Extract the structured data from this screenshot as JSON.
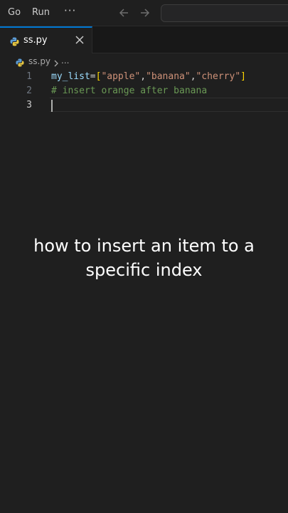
{
  "menubar": {
    "items": [
      "Go",
      "Run"
    ],
    "more": "···",
    "back_icon": "arrow-left-icon",
    "forward_icon": "arrow-right-icon"
  },
  "tab": {
    "label": "ss.py",
    "icon": "python-icon",
    "close_icon": "close-icon"
  },
  "breadcrumb": {
    "file": "ss.py",
    "separator_icon": "chevron-right-icon",
    "ellipsis": "..."
  },
  "editor": {
    "lines": [
      {
        "number": "1"
      },
      {
        "number": "2"
      },
      {
        "number": "3"
      }
    ],
    "line1": {
      "var": "my_list",
      "op": "=",
      "open": "[",
      "s1": "\"apple\"",
      "c1": ",",
      "s2": "\"banana\"",
      "c2": ",",
      "s3": "\"cherry\"",
      "close": "]"
    },
    "line2": {
      "comment": "# insert orange after banana"
    }
  },
  "caption": {
    "line1": "how to insert an item to a",
    "line2": "specific index"
  },
  "colors": {
    "background": "#1f1f1f",
    "accent": "#0078d4",
    "string": "#ce9178",
    "variable": "#9cdcfe",
    "comment": "#6a9955",
    "bracket": "#ffd700"
  }
}
